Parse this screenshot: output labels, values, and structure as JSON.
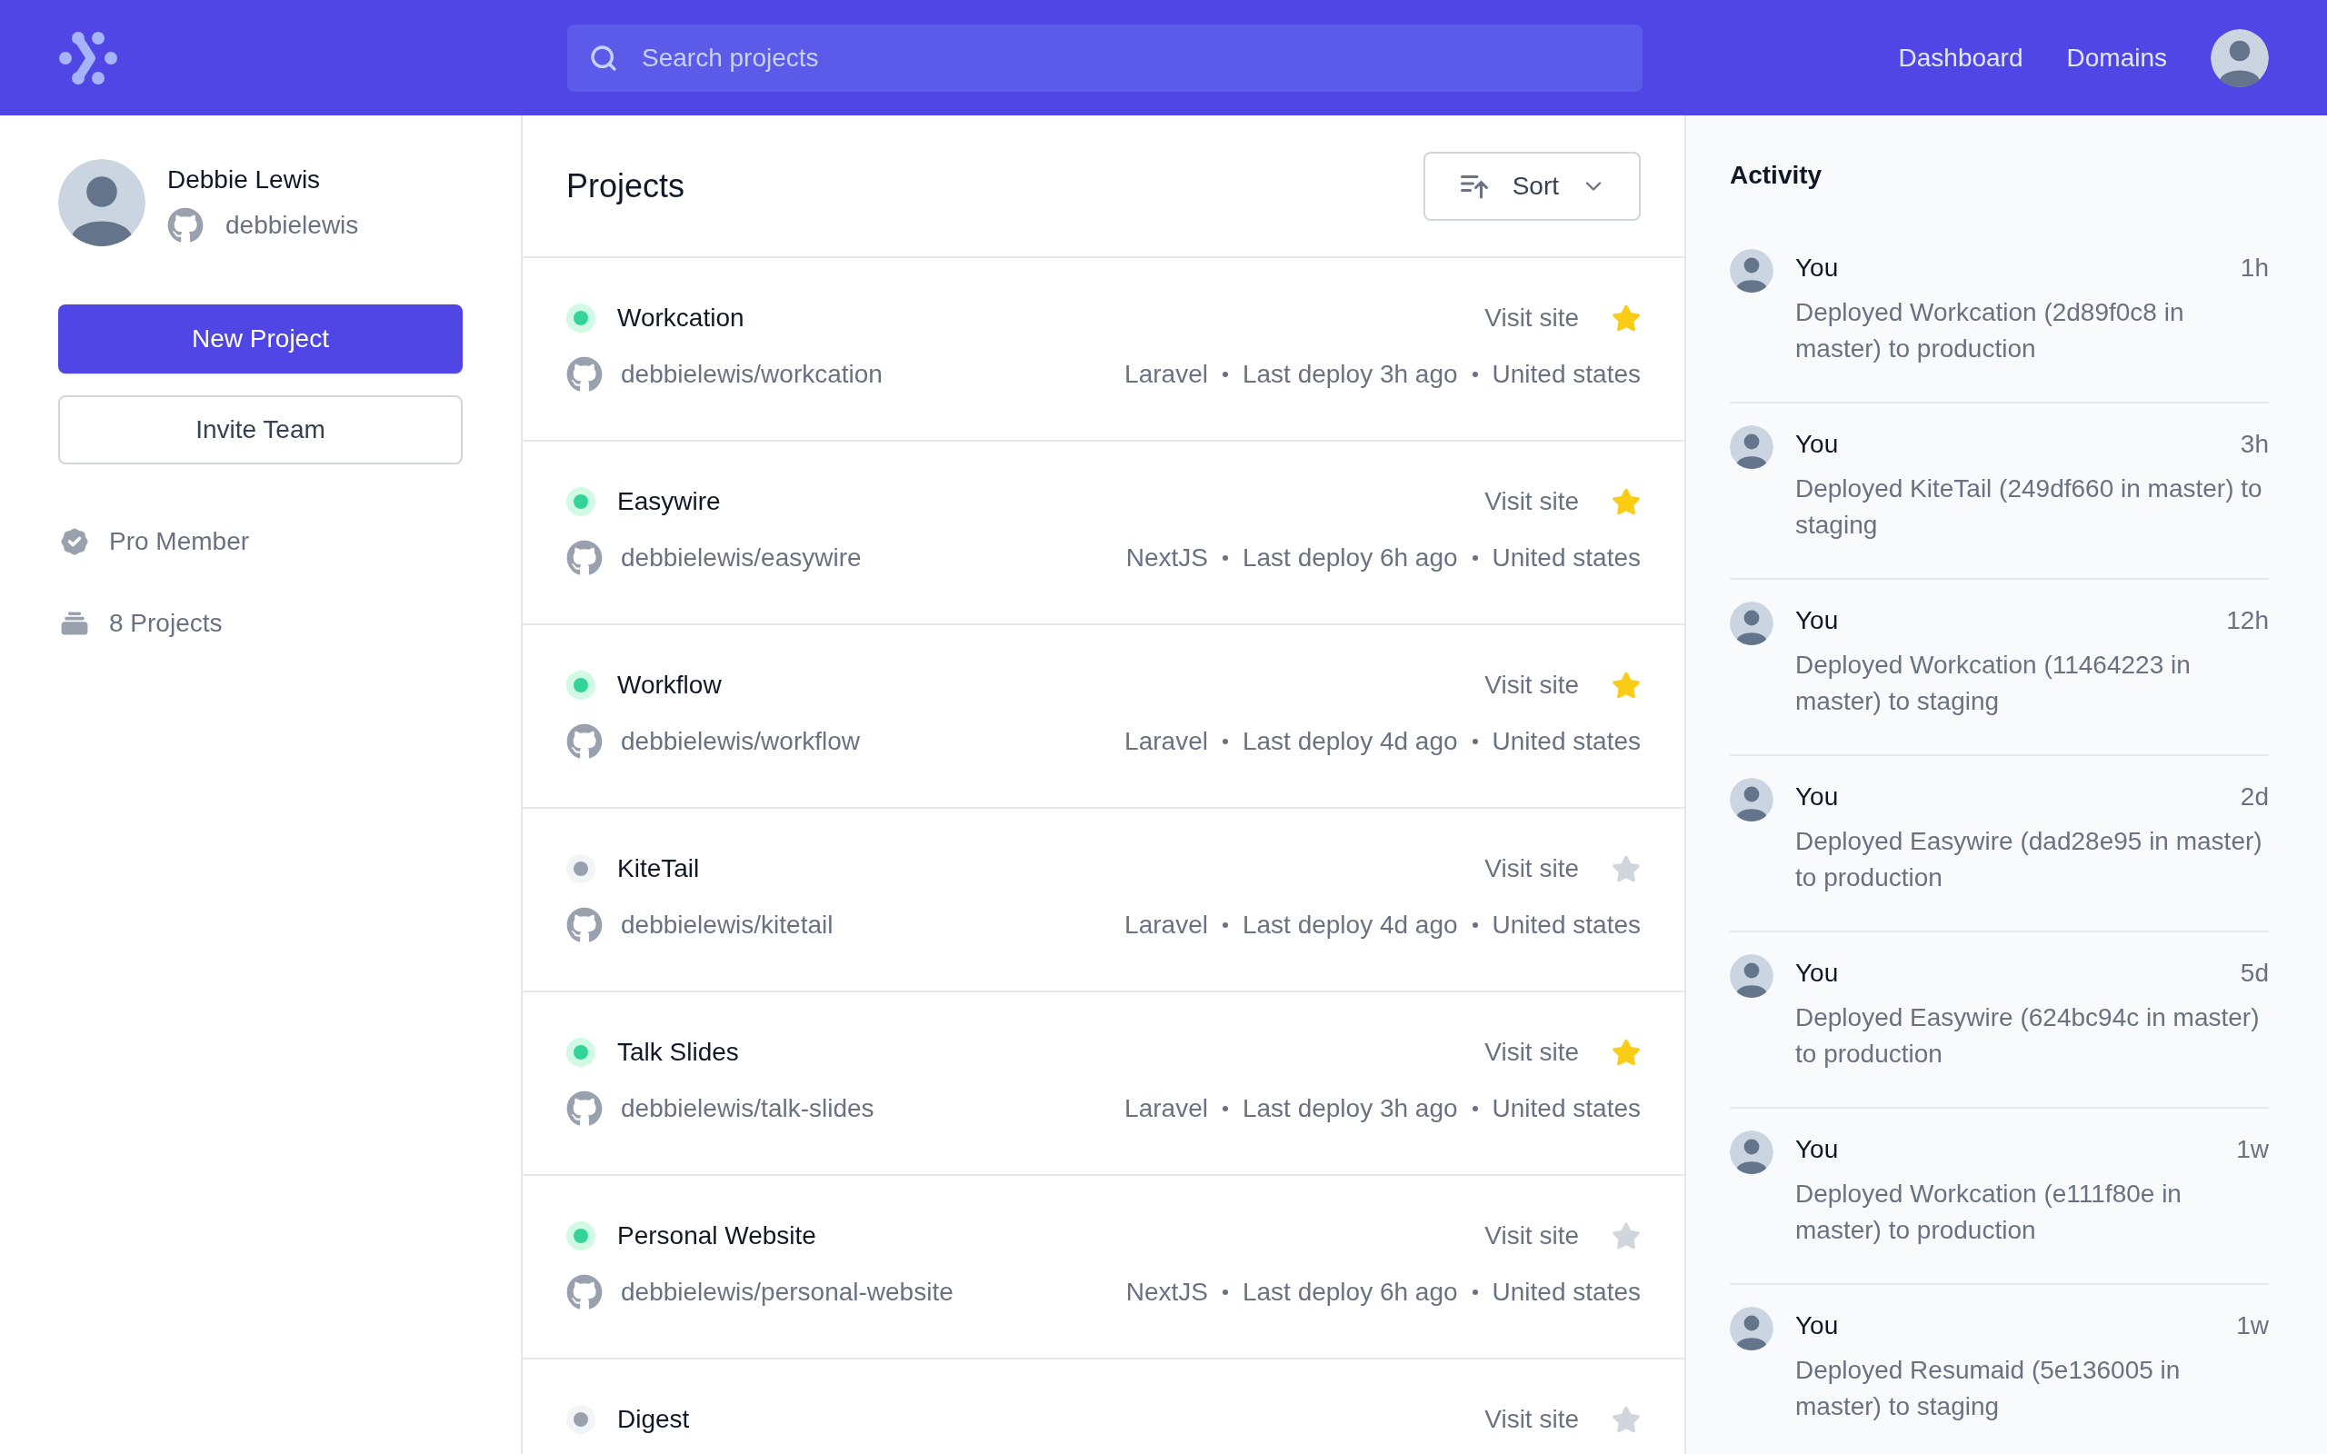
{
  "header": {
    "search": {
      "placeholder": "Search projects"
    },
    "nav": [
      "Dashboard",
      "Domains"
    ]
  },
  "profile": {
    "name": "Debbie Lewis",
    "username": "debbielewis"
  },
  "buttons": {
    "primary": "New Project",
    "secondary": "Invite Team"
  },
  "stats": [
    {
      "kind": "badge",
      "label": "Pro Member"
    },
    {
      "kind": "collection",
      "label": "8 Projects"
    }
  ],
  "projects": {
    "title": "Projects",
    "sort": "Sort",
    "items": [
      {
        "name": "Workcation",
        "active": true,
        "starred": true,
        "link": "Visit site",
        "repo": "debbielewis/workcation",
        "meta": [
          "Laravel",
          "Last deploy 3h ago",
          "United states"
        ]
      },
      {
        "name": "Easywire",
        "active": true,
        "starred": true,
        "link": "Visit site",
        "repo": "debbielewis/easywire",
        "meta": [
          "NextJS",
          "Last deploy 6h ago",
          "United states"
        ]
      },
      {
        "name": "Workflow",
        "active": true,
        "starred": true,
        "link": "Visit site",
        "repo": "debbielewis/workflow",
        "meta": [
          "Laravel",
          "Last deploy 4d ago",
          "United states"
        ]
      },
      {
        "name": "KiteTail",
        "active": false,
        "starred": false,
        "link": "Visit site",
        "repo": "debbielewis/kitetail",
        "meta": [
          "Laravel",
          "Last deploy 4d ago",
          "United states"
        ]
      },
      {
        "name": "Talk Slides",
        "active": true,
        "starred": true,
        "link": "Visit site",
        "repo": "debbielewis/talk-slides",
        "meta": [
          "Laravel",
          "Last deploy 3h ago",
          "United states"
        ]
      },
      {
        "name": "Personal Website",
        "active": true,
        "starred": false,
        "link": "Visit site",
        "repo": "debbielewis/personal-website",
        "meta": [
          "NextJS",
          "Last deploy 6h ago",
          "United states"
        ]
      },
      {
        "name": "Digest",
        "active": false,
        "starred": false,
        "link": "Visit site"
      }
    ]
  },
  "activity": {
    "title": "Activity",
    "items": [
      {
        "user": "You",
        "time": "1h",
        "text": "Deployed Workcation (2d89f0c8 in master) to production"
      },
      {
        "user": "You",
        "time": "3h",
        "text": "Deployed KiteTail (249df660 in master) to staging"
      },
      {
        "user": "You",
        "time": "12h",
        "text": "Deployed Workcation (11464223 in master) to staging"
      },
      {
        "user": "You",
        "time": "2d",
        "text": "Deployed Easywire (dad28e95 in master) to production"
      },
      {
        "user": "You",
        "time": "5d",
        "text": "Deployed Easywire (624bc94c in master) to production"
      },
      {
        "user": "You",
        "time": "1w",
        "text": "Deployed Workcation (e111f80e in master) to production"
      },
      {
        "user": "You",
        "time": "1w",
        "text": "Deployed Resumaid (5e136005 in master) to staging"
      }
    ]
  }
}
